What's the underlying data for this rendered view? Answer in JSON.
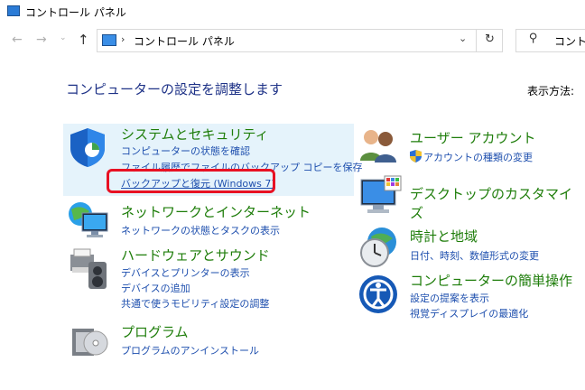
{
  "window": {
    "title": "コントロール パネル"
  },
  "address_bar": {
    "breadcrumb": "コントロール パネル",
    "search_placeholder": "コントロー"
  },
  "main": {
    "heading": "コンピューターの設定を調整します",
    "view_by_label": "表示方法:"
  },
  "categories_left": [
    {
      "title": "システムとセキュリティ",
      "links": [
        "コンピューターの状態を確認",
        "ファイル履歴でファイルのバックアップ コピーを保存",
        "バックアップと復元 (Windows 7)"
      ]
    },
    {
      "title": "ネットワークとインターネット",
      "links": [
        "ネットワークの状態とタスクの表示"
      ]
    },
    {
      "title": "ハードウェアとサウンド",
      "links": [
        "デバイスとプリンターの表示",
        "デバイスの追加",
        "共通で使うモビリティ設定の調整"
      ]
    },
    {
      "title": "プログラム",
      "links": [
        "プログラムのアンインストール"
      ]
    }
  ],
  "categories_right": [
    {
      "title": "ユーザー アカウント",
      "links": [
        "アカウントの種類の変更"
      ]
    },
    {
      "title": "デスクトップのカスタマイズ",
      "links": []
    },
    {
      "title": "時計と地域",
      "links": [
        "日付、時刻、数値形式の変更"
      ]
    },
    {
      "title": "コンピューターの簡単操作",
      "links": [
        "設定の提案を表示",
        "視覚ディスプレイの最適化"
      ]
    }
  ],
  "colors": {
    "category_title": "#1e7d0a",
    "link": "#1e4fae",
    "heading": "#1e3287",
    "highlight_bg": "#e5f3fb",
    "annotation_red": "#e81123"
  }
}
